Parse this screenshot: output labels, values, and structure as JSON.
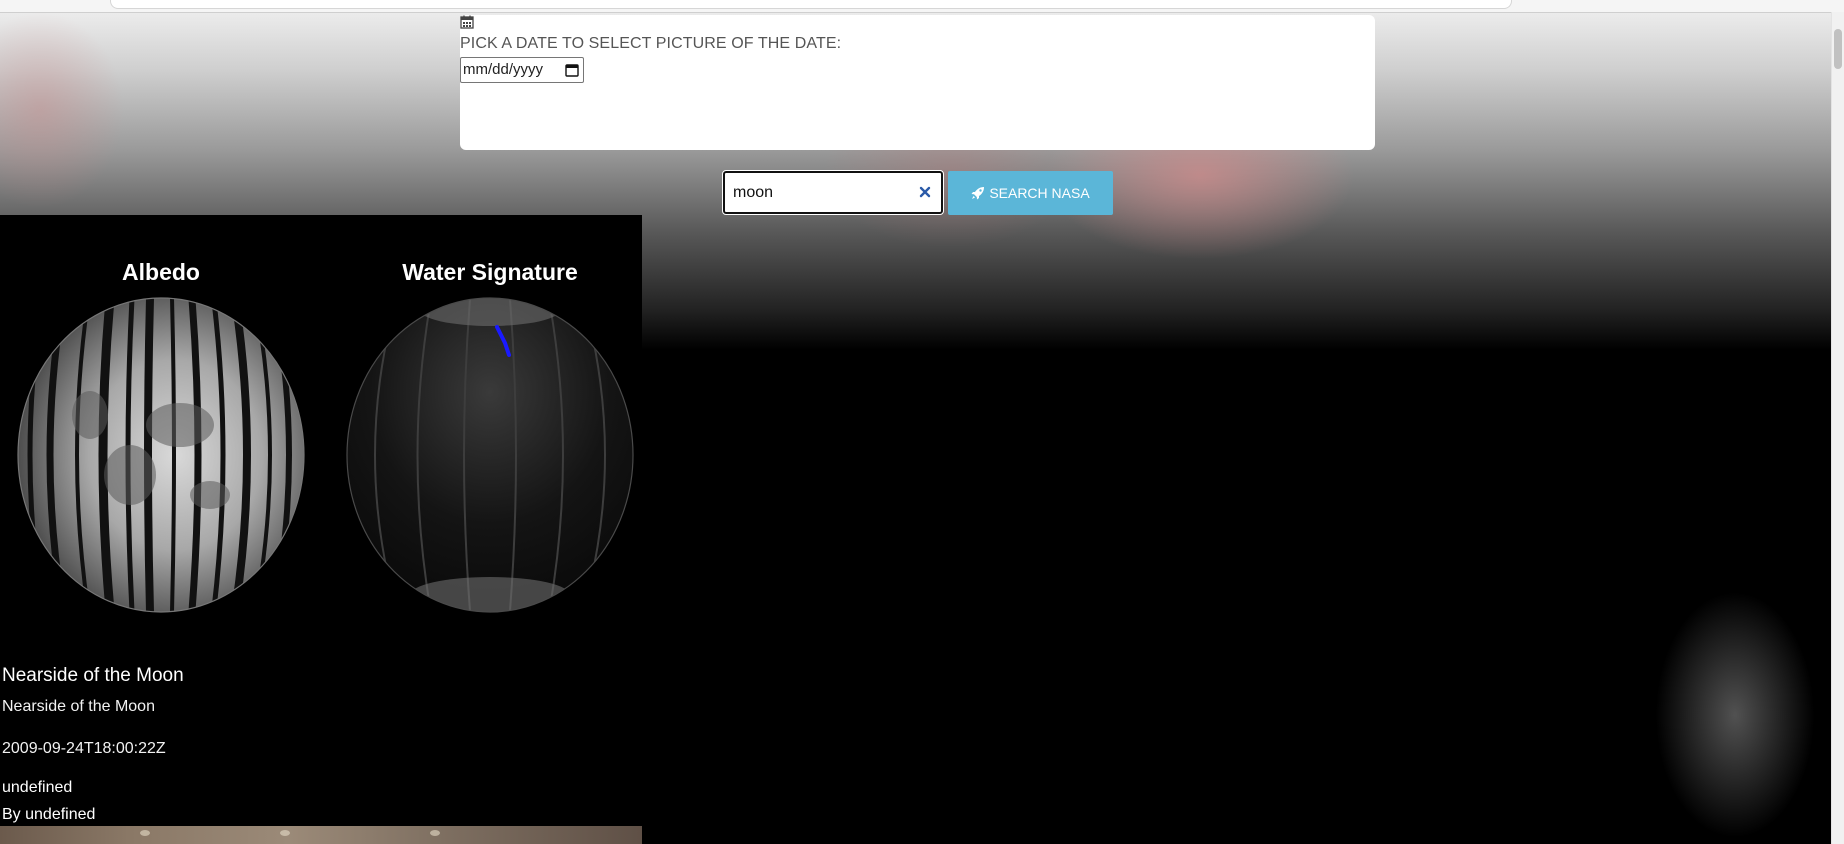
{
  "date_picker": {
    "label": "PICK A DATE TO SELECT PICTURE OF THE DATE:",
    "placeholder": "mm/dd/yyyy"
  },
  "search": {
    "value": "moon",
    "button_label": "SEARCH NASA"
  },
  "result": {
    "image_labels": [
      "Albedo",
      "Water Signature"
    ],
    "title": "Nearside of the Moon",
    "description": "Nearside of the Moon",
    "date_created": "2009-09-24T18:00:22Z",
    "field_1": "undefined",
    "byline_prefix": "By",
    "byline_value": "undefined"
  },
  "colors": {
    "search_button": "#5bb6d8",
    "clear_icon": "#2a5aa8",
    "water_arrow": "#1a1aff"
  },
  "icons": {
    "date_card": "calendar-icon",
    "search_clear": "close-icon",
    "search_button": "rocket-icon"
  }
}
